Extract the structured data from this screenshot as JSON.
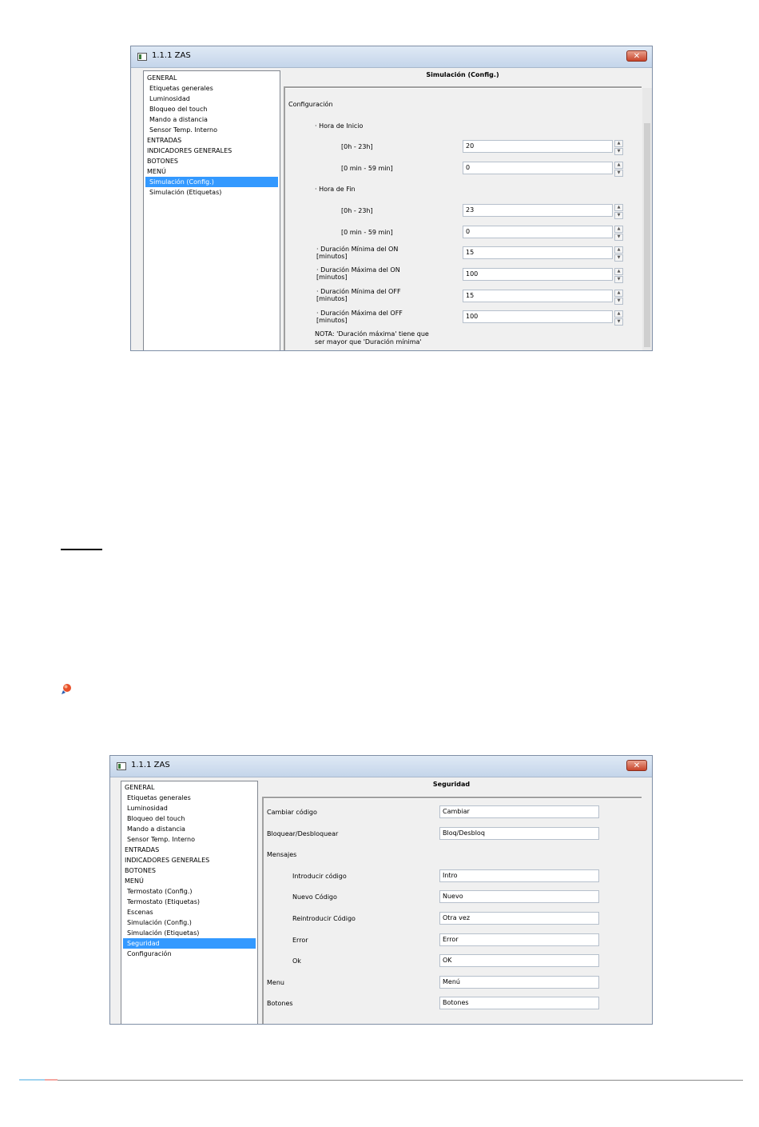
{
  "window1": {
    "title": "1.1.1 ZAS",
    "close_label": "✕",
    "tree": [
      {
        "label": "GENERAL",
        "level": 0,
        "selected": false
      },
      {
        "label": "Etiquetas generales",
        "level": 1,
        "selected": false
      },
      {
        "label": "Luminosidad",
        "level": 1,
        "selected": false
      },
      {
        "label": "Bloqueo del touch",
        "level": 1,
        "selected": false
      },
      {
        "label": "Mando a distancia",
        "level": 1,
        "selected": false
      },
      {
        "label": "Sensor Temp. Interno",
        "level": 1,
        "selected": false
      },
      {
        "label": "ENTRADAS",
        "level": 0,
        "selected": false
      },
      {
        "label": "INDICADORES GENERALES",
        "level": 0,
        "selected": false
      },
      {
        "label": "BOTONES",
        "level": 0,
        "selected": false
      },
      {
        "label": "MENÚ",
        "level": 0,
        "selected": false
      },
      {
        "label": "Simulación (Config.)",
        "level": 1,
        "selected": true
      },
      {
        "label": "Simulación (Etiquetas)",
        "level": 1,
        "selected": false
      }
    ],
    "panel_title": "Simulación (Config.)",
    "section": "Configuración",
    "start_heading": "· Hora de Inicio",
    "start_hour_label": "[0h - 23h]",
    "start_hour_value": "20",
    "start_min_label": "[0 min - 59 min]",
    "start_min_value": "0",
    "end_heading": "· Hora de Fin",
    "end_hour_label": "[0h - 23h]",
    "end_hour_value": "23",
    "end_min_label": "[0 min - 59 min]",
    "end_min_value": "0",
    "min_on_label1": "· Duración Mínima del ON",
    "min_on_label2": "[minutos]",
    "min_on_value": "15",
    "max_on_label1": "· Duración Máxima del ON",
    "max_on_label2": "[minutos]",
    "max_on_value": "100",
    "min_off_label1": "· Duración Mínima del OFF",
    "min_off_label2": "[minutos]",
    "min_off_value": "15",
    "max_off_label1": "· Duración Máxima del OFF",
    "max_off_label2": "[minutos]",
    "max_off_value": "100",
    "note_line1": "NOTA: 'Duración máxima' tiene que",
    "note_line2": "ser mayor que 'Duración mínima'"
  },
  "window2": {
    "title": "1.1.1 ZAS",
    "close_label": "✕",
    "tree": [
      {
        "label": "GENERAL",
        "level": 0,
        "selected": false
      },
      {
        "label": "Etiquetas generales",
        "level": 1,
        "selected": false
      },
      {
        "label": "Luminosidad",
        "level": 1,
        "selected": false
      },
      {
        "label": "Bloqueo del touch",
        "level": 1,
        "selected": false
      },
      {
        "label": "Mando a distancia",
        "level": 1,
        "selected": false
      },
      {
        "label": "Sensor Temp. Interno",
        "level": 1,
        "selected": false
      },
      {
        "label": "ENTRADAS",
        "level": 0,
        "selected": false
      },
      {
        "label": "INDICADORES GENERALES",
        "level": 0,
        "selected": false
      },
      {
        "label": "BOTONES",
        "level": 0,
        "selected": false
      },
      {
        "label": "MENÚ",
        "level": 0,
        "selected": false
      },
      {
        "label": "Termostato (Config.)",
        "level": 1,
        "selected": false
      },
      {
        "label": "Termostato (Etiquetas)",
        "level": 1,
        "selected": false
      },
      {
        "label": "Escenas",
        "level": 1,
        "selected": false
      },
      {
        "label": "Simulación (Config.)",
        "level": 1,
        "selected": false
      },
      {
        "label": "Simulación (Etiquetas)",
        "level": 1,
        "selected": false
      },
      {
        "label": "Seguridad",
        "level": 1,
        "selected": true
      },
      {
        "label": "Configuración",
        "level": 1,
        "selected": false
      }
    ],
    "panel_title": "Seguridad",
    "rows": [
      {
        "label": "Cambiar código",
        "value": "Cambiar",
        "indent": false
      },
      {
        "label": "Bloquear/Desbloquear",
        "value": "Bloq/Desbloq",
        "indent": false
      },
      {
        "label": "Mensajes",
        "value": null,
        "indent": false
      },
      {
        "label": "Introducir código",
        "value": "Intro",
        "indent": true
      },
      {
        "label": "Nuevo Código",
        "value": "Nuevo",
        "indent": true
      },
      {
        "label": "Reintroducir Código",
        "value": "Otra vez",
        "indent": true
      },
      {
        "label": "Error",
        "value": "Error",
        "indent": true
      },
      {
        "label": "Ok",
        "value": "OK",
        "indent": true
      },
      {
        "label": "Menu",
        "value": "Menú",
        "indent": false
      },
      {
        "label": "Botones",
        "value": "Botones",
        "indent": false
      }
    ]
  },
  "colors": {
    "selection": "#3399ff",
    "footer_accent_1": "#9fd3ef",
    "footer_accent_2": "#f4a6a0"
  },
  "icons": {
    "hint": "pencil-hint-icon",
    "close": "close-icon",
    "spin": "spin-arrows-icon"
  }
}
